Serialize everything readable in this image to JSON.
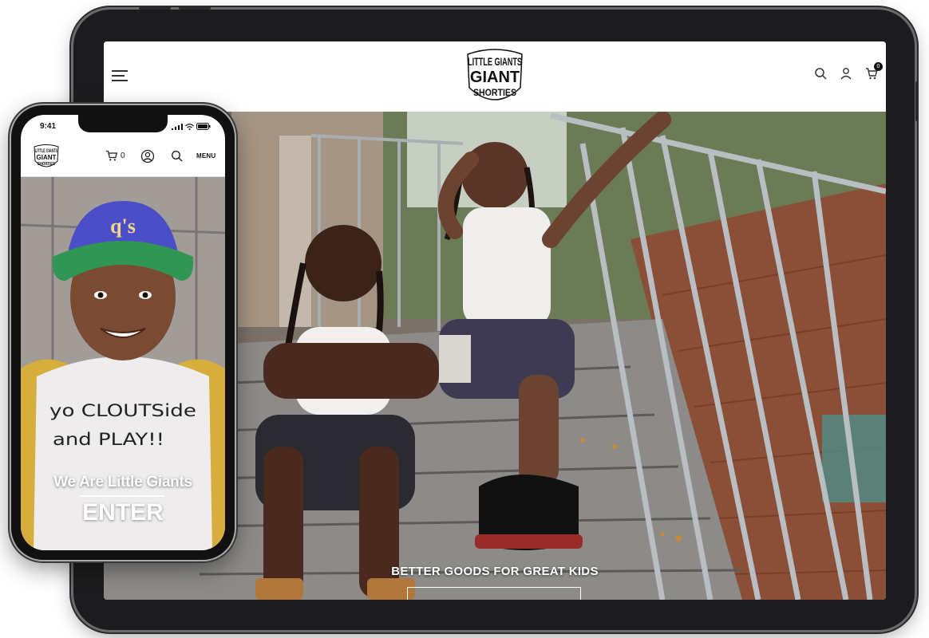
{
  "tablet": {
    "header": {
      "logo_lines": [
        "LITTLE GIANTS",
        "GIANT",
        "SHORTIES"
      ],
      "cart_count": "0"
    },
    "hero": {
      "tagline": "BETTER GOODS FOR GREAT KIDS",
      "button_label": ""
    }
  },
  "phone": {
    "status": {
      "time": "9:41"
    },
    "header": {
      "cart_count": "0",
      "menu_label": "MENU"
    },
    "hero": {
      "shirt_text": [
        "yo CLOUTSide",
        "and PLAY!!"
      ],
      "cap_text": "q's",
      "tagline": "We Are Little Giants",
      "cta": "ENTER"
    }
  },
  "icons": [
    "hamburger-menu-icon",
    "search-icon",
    "user-icon",
    "cart-icon",
    "signal-icon",
    "wifi-icon",
    "battery-icon"
  ],
  "colors": {
    "frame": "#1c1c1e",
    "header_bg": "#ffffff",
    "text_light": "#ffffff"
  }
}
